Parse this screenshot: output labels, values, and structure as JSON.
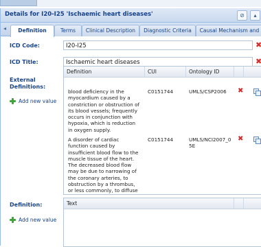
{
  "header": {
    "title": "Details for I20-I25 'Ischaemic heart diseases'"
  },
  "tabs": [
    "Definition",
    "Terms",
    "Clinical Description",
    "Diagnostic Criteria",
    "Causal Mechanism and"
  ],
  "form": {
    "icd_code_label": "ICD Code:",
    "icd_code_value": "I20-I25",
    "icd_title_label": "ICD Title:",
    "icd_title_value": "Ischaemic heart diseases",
    "external_label": "External Definitions:",
    "add_new_value": "Add new value",
    "definition_label": "Definition:",
    "add_new_value_2": "Add new value"
  },
  "external_table": {
    "columns": [
      "Definition",
      "CUI",
      "Ontology ID"
    ],
    "rows": [
      {
        "definition_lines": [
          "blood deficiency in the",
          "myocardium caused by a",
          "constriction or obstruction of",
          "its blood vessels; frequently",
          "occurs in conjunction with",
          "hypoxia, which is reduction",
          "in oxygen supply."
        ],
        "cui": "C0151744",
        "ontology": "UMLS/CSP2006"
      },
      {
        "definition_lines": [
          "A disorder of cardiac",
          "function caused by",
          "insufficient blood flow to the",
          "muscle tissue of the heart.",
          "The decreased blood flow",
          "may be due to narrowing of",
          "the coronary arteries, to",
          "obstruction by a thrombus,",
          "or less commonly, to diffuse"
        ],
        "cui": "C0151744",
        "ontology_lines": [
          "UMLS/NCI2007_0",
          "5E"
        ]
      }
    ]
  },
  "definition_table": {
    "columns": [
      "Text"
    ]
  },
  "colors": {
    "header_text": "#15428b",
    "delete_red": "#d42b2b",
    "add_green": "#3fa43a",
    "border_blue": "#99bbe8"
  }
}
